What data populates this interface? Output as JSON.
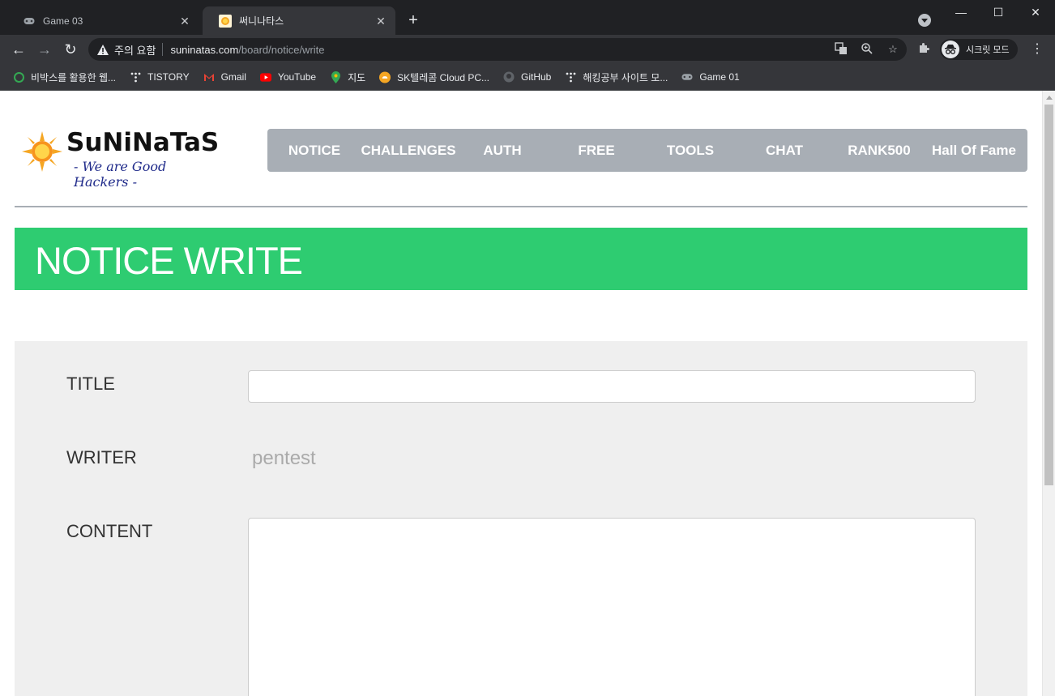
{
  "browser": {
    "tabs": [
      {
        "title": "Game 03",
        "active": false,
        "icon": "gamepad-icon"
      },
      {
        "title": "써니나타스",
        "active": true,
        "icon": "sun-favicon-icon"
      }
    ],
    "new_tab_symbol": "+",
    "window_controls": {
      "minimize": "—",
      "maximize": "☐",
      "close": "✕"
    },
    "security_warning": "주의 요함",
    "url_host": "suninatas.com",
    "url_path": "/board/notice/write",
    "incognito_label": "시크릿 모드",
    "bookmarks": [
      {
        "label": "비박스를 활용한 웹...",
        "icon": "green-circle-icon"
      },
      {
        "label": "TISTORY",
        "icon": "tistory-icon"
      },
      {
        "label": "Gmail",
        "icon": "gmail-icon"
      },
      {
        "label": "YouTube",
        "icon": "youtube-icon"
      },
      {
        "label": "지도",
        "icon": "maps-pin-icon"
      },
      {
        "label": "SK텔레콤 Cloud PC...",
        "icon": "cloud-icon"
      },
      {
        "label": "GitHub",
        "icon": "github-icon"
      },
      {
        "label": "해킹공부 사이트 모...",
        "icon": "tistory-icon"
      },
      {
        "label": "Game 01",
        "icon": "gamepad-icon"
      }
    ]
  },
  "site": {
    "logo_text": "SuNiNaTaS",
    "logo_tagline": "- We are Good Hackers -",
    "nav": [
      "NOTICE",
      "CHALLENGES",
      "AUTH",
      "FREE",
      "TOOLS",
      "CHAT",
      "RANK500",
      "Hall Of Fame"
    ],
    "page_title": "NOTICE WRITE",
    "form": {
      "title_label": "TITLE",
      "title_value": "",
      "writer_label": "WRITER",
      "writer_value": "pentest",
      "content_label": "CONTENT",
      "content_value": ""
    }
  },
  "colors": {
    "banner": "#2ecc71",
    "nav_bg": "#a8aeb5",
    "form_bg": "#efefef"
  }
}
